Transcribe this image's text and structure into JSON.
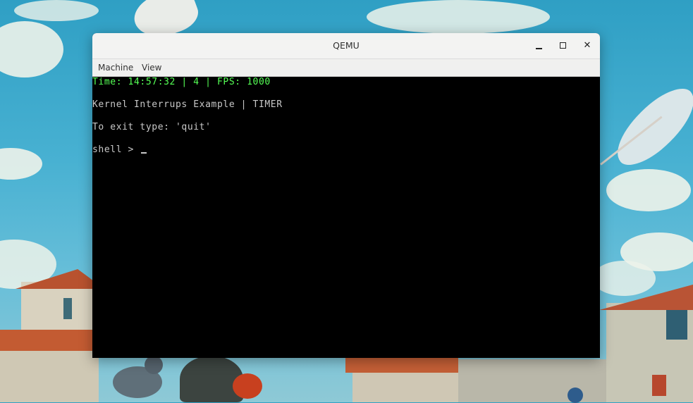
{
  "window": {
    "title": "QEMU",
    "minimize_label": "_",
    "maximize_label": "□",
    "close_label": "✕"
  },
  "menubar": {
    "items": [
      {
        "label": "Machine"
      },
      {
        "label": "View"
      }
    ]
  },
  "console": {
    "status_line": "Time: 14:57:32 | 4 | FPS: 1000",
    "lines": [
      "Kernel Interrups Example | TIMER",
      "To exit type: 'quit'",
      "shell > "
    ]
  },
  "colors": {
    "status_text": "#55ff55",
    "console_text": "#c8c8c8",
    "console_bg": "#000000"
  }
}
